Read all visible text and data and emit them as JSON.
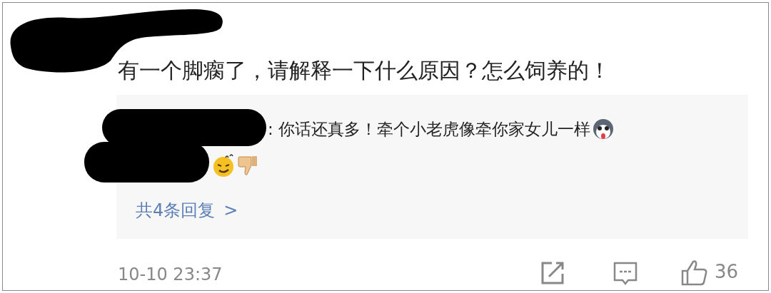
{
  "comment": {
    "text": "有一个脚瘸了，请解释一下什么原因？怎么饲养的！"
  },
  "replies": {
    "items": [
      {
        "text": ": 你话还真多！牵个小老虎像牵你家女儿一样"
      }
    ],
    "more_link": "共4条回复",
    "more_arrow": ">"
  },
  "footer": {
    "time": "10-10 23:37",
    "likes": "36"
  }
}
